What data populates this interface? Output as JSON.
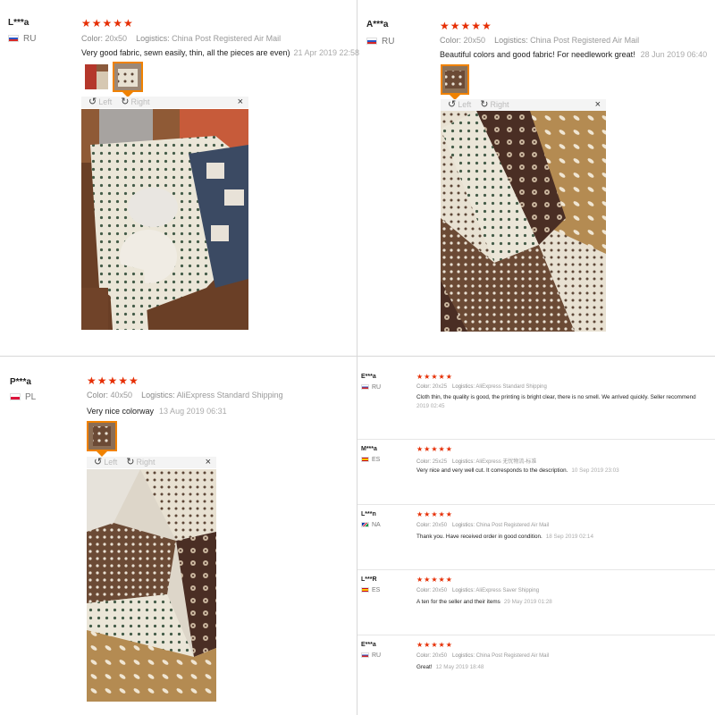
{
  "reviews": [
    {
      "user": "L***a",
      "country": "RU",
      "stars": "★★★★★",
      "color_label": "Color:",
      "color": "20x50",
      "logistics_label": "Logistics:",
      "logistics": "China Post Registered Air Mail",
      "text": "Very good fabric, sewn easily, thin, all the pieces are even)",
      "date": "21 Apr 2019 22:58",
      "viewer": {
        "left": "Left",
        "right": "Right",
        "close": "×"
      }
    },
    {
      "user": "A***a",
      "country": "RU",
      "stars": "★★★★★",
      "color_label": "Color:",
      "color": "20x50",
      "logistics_label": "Logistics:",
      "logistics": "China Post Registered Air Mail",
      "text": "Beautiful colors and good fabric! For needlework great!",
      "date": "28 Jun 2019 06:40",
      "viewer": {
        "left": "Left",
        "right": "Right",
        "close": "×"
      }
    },
    {
      "user": "P***a",
      "country": "PL",
      "stars": "★★★★★",
      "color_label": "Color:",
      "color": "40x50",
      "logistics_label": "Logistics:",
      "logistics": "AliExpress Standard Shipping",
      "text": "Very nice colorway",
      "date": "13 Aug 2019 06:31",
      "viewer": {
        "left": "Left",
        "right": "Right",
        "close": "×"
      }
    }
  ],
  "small_reviews": [
    {
      "user": "E***a",
      "country": "RU",
      "stars": "★★★★★",
      "color_label": "Color:",
      "color": "20x25",
      "logistics_label": "Logistics:",
      "logistics": "AliExpress Standard Shipping",
      "text_line1": "Cloth thin, the quality is good, the printing is bright clear, there is no smell. We arrived quickly. Seller recommend",
      "date": "2019 02:45"
    },
    {
      "user": "M***a",
      "country": "ES",
      "stars": "★★★★★",
      "color_label": "Color:",
      "color": "25x25",
      "logistics_label": "Logistics:",
      "logistics": "AliExpress 无忧物流-标准",
      "text": "Very nice and very well cut. It corresponds to the description.",
      "date": "10 Sep 2019 23:03"
    },
    {
      "user": "L***n",
      "country": "NA",
      "stars": "★★★★★",
      "color_label": "Color:",
      "color": "20x50",
      "logistics_label": "Logistics:",
      "logistics": "China Post Registered Air Mail",
      "text": "Thank you. Have received order in good condition.",
      "date": "18 Sep 2019 02:14"
    },
    {
      "user": "L***R",
      "country": "ES",
      "stars": "★★★★★",
      "color_label": "Color:",
      "color": "20x50",
      "logistics_label": "Logistics:",
      "logistics": "AliExpress Saver Shipping",
      "text": "A ten for the seller and their items",
      "date": "29 May 2019 01:28"
    },
    {
      "user": "E***a",
      "country": "RU",
      "stars": "★★★★★",
      "color_label": "Color:",
      "color": "20x50",
      "logistics_label": "Logistics:",
      "logistics": "China Post Registered Air Mail",
      "text": "Great!",
      "date": "12 May 2019 18:48"
    }
  ],
  "icons": {
    "rotate_left": "↺",
    "rotate_right": "↻"
  }
}
